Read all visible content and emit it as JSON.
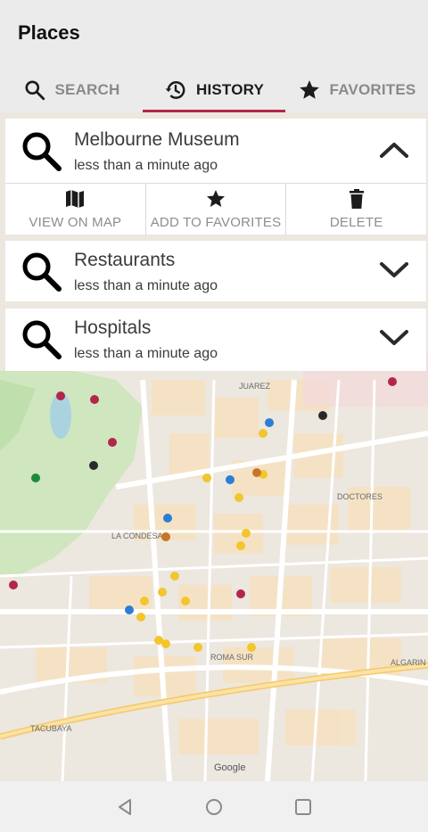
{
  "app": {
    "title": "Places"
  },
  "tabs": [
    {
      "label": "SEARCH",
      "icon": "search-icon",
      "active": false
    },
    {
      "label": "HISTORY",
      "icon": "history-icon",
      "active": true
    },
    {
      "label": "FAVORITES",
      "icon": "star-icon",
      "active": false
    }
  ],
  "history": [
    {
      "title": "Melbourne Museum",
      "time": "less than a minute ago",
      "expanded": true
    },
    {
      "title": "Restaurants",
      "time": "less than a minute ago",
      "expanded": false
    },
    {
      "title": "Hospitals",
      "time": "less than a minute ago",
      "expanded": false
    }
  ],
  "actions": [
    {
      "label": "VIEW ON MAP",
      "icon": "map-icon"
    },
    {
      "label": "ADD TO FAVORITES",
      "icon": "star-icon"
    },
    {
      "label": "DELETE",
      "icon": "trash-icon"
    }
  ],
  "map": {
    "labels": {
      "district_1": "LA CONDESA",
      "district_2": "DOCTORES",
      "district_3": "ROMA SUR",
      "district_4": "JUAREZ",
      "district_5": "ALGARIN",
      "district_6": "TACUBAYA",
      "attribution": "Google"
    }
  },
  "colors": {
    "accent": "#b3264b",
    "park": "#cfe6bf",
    "pin_hospital": "#b3264b",
    "pin_restaurant": "#f2c62c",
    "pin_museum": "#2a2a2a",
    "pin_blue": "#2a7fd4",
    "pin_green": "#1b8a3c"
  },
  "navbar": {
    "back": "back-icon",
    "home": "home-icon",
    "recents": "recents-icon"
  }
}
